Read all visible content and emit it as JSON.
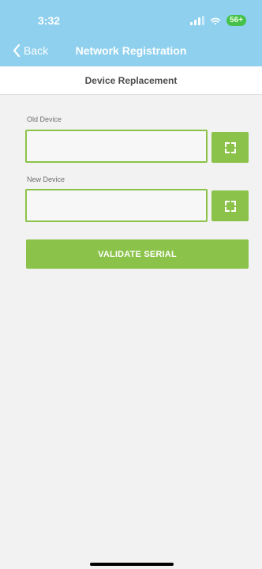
{
  "status_bar": {
    "time": "3:32",
    "battery": "56+"
  },
  "nav": {
    "back_label": "Back",
    "title": "Network Registration"
  },
  "section": {
    "title": "Device Replacement"
  },
  "form": {
    "old_device_label": "Old Device",
    "old_device_value": "",
    "new_device_label": "New Device",
    "new_device_value": "",
    "validate_label": "VALIDATE SERIAL"
  },
  "icons": {
    "back": "chevron-left-icon",
    "scan": "scan-frame-icon",
    "signal": "signal-icon",
    "wifi": "wifi-icon",
    "battery": "battery-icon"
  },
  "colors": {
    "header": "#8fd0ee",
    "accent_green": "#8bc34a",
    "battery_green": "#45c14a",
    "background": "#f2f2f2"
  }
}
